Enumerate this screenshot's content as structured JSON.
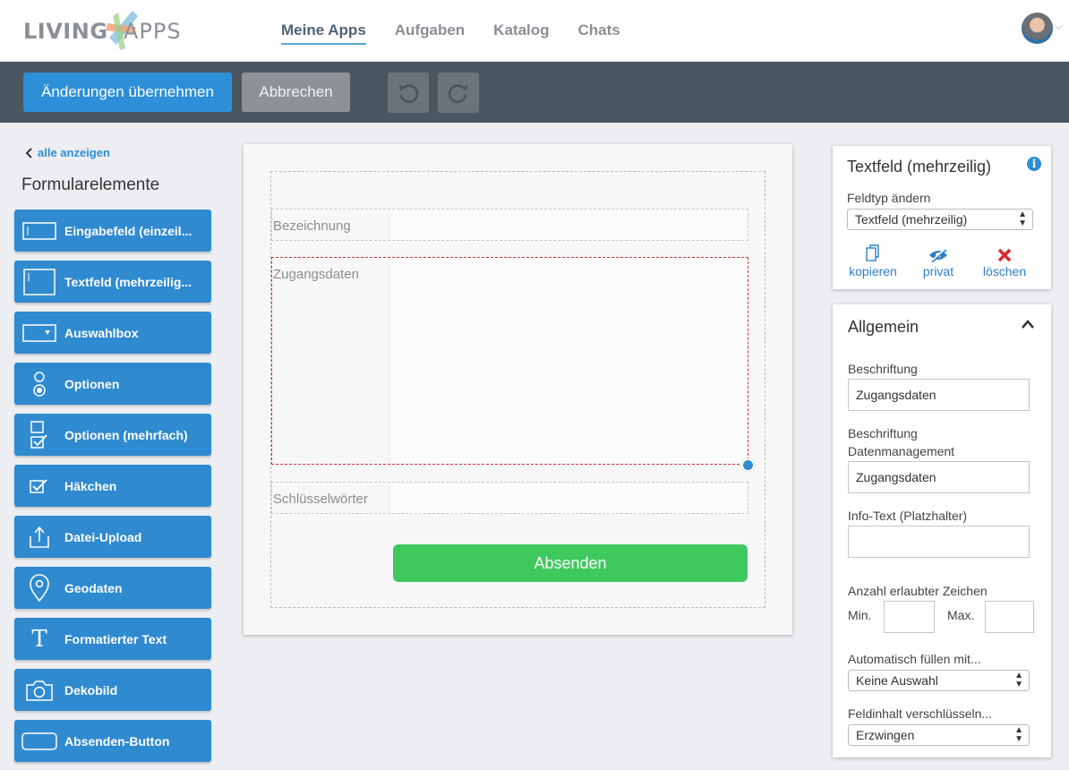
{
  "nav": {
    "logo_left": "LIVING",
    "logo_right": "APPS",
    "items": [
      {
        "label": "Meine Apps"
      },
      {
        "label": "Aufgaben"
      },
      {
        "label": "Katalog"
      },
      {
        "label": "Chats"
      }
    ]
  },
  "toolbar": {
    "apply_label": "Änderungen übernehmen",
    "cancel_label": "Abbrechen",
    "undo_icon": "undo-icon",
    "redo_icon": "redo-icon"
  },
  "sidebar": {
    "back_label": "alle anzeigen",
    "title": "Formularelemente",
    "elements": [
      {
        "label": "Eingabefeld (einzeil...",
        "icon": "textfield-icon"
      },
      {
        "label": "Textfeld (mehrzeilig...",
        "icon": "textarea-icon"
      },
      {
        "label": "Auswahlbox",
        "icon": "select-icon"
      },
      {
        "label": "Optionen",
        "icon": "radio-icon"
      },
      {
        "label": "Optionen (mehrfach)",
        "icon": "checkbox-multi-icon"
      },
      {
        "label": "Häkchen",
        "icon": "checkbox-icon"
      },
      {
        "label": "Datei-Upload",
        "icon": "upload-icon"
      },
      {
        "label": "Geodaten",
        "icon": "location-pin-icon"
      },
      {
        "label": "Formatierter Text",
        "icon": "text-format-icon"
      },
      {
        "label": "Dekobild",
        "icon": "camera-icon"
      },
      {
        "label": "Absenden-Button",
        "icon": "button-icon"
      }
    ]
  },
  "form": {
    "fields": [
      {
        "label": "Bezeichnung"
      },
      {
        "label": "Zugangsdaten"
      },
      {
        "label": "Schlüsselwörter"
      }
    ],
    "submit_label": "Absenden"
  },
  "properties": {
    "title": "Textfeld (mehrzeilig)",
    "change_type_label": "Feldtyp ändern",
    "type_value": "Textfeld (mehrzeilig)",
    "actions": {
      "copy": "kopieren",
      "private": "privat",
      "delete": "löschen"
    }
  },
  "general": {
    "title": "Allgemein",
    "caption_label": "Beschriftung",
    "caption_value": "Zugangsdaten",
    "caption_dm_label": "Beschriftung Datenmanagement",
    "caption_dm_value": "Zugangsdaten",
    "info_label": "Info-Text (Platzhalter)",
    "info_value": "",
    "chars_label": "Anzahl erlaubter Zeichen",
    "min_label": "Min.",
    "max_label": "Max.",
    "autofill_label": "Automatisch füllen mit...",
    "autofill_value": "Keine Auswahl",
    "encrypt_label": "Feldinhalt verschlüsseln...",
    "encrypt_value": "Erzwingen"
  },
  "colors": {
    "primary": "#2f8ad0",
    "toolbar": "#4a5660",
    "submit": "#3ec95f",
    "selected_border": "#d0303f",
    "delete": "#d9272e"
  }
}
